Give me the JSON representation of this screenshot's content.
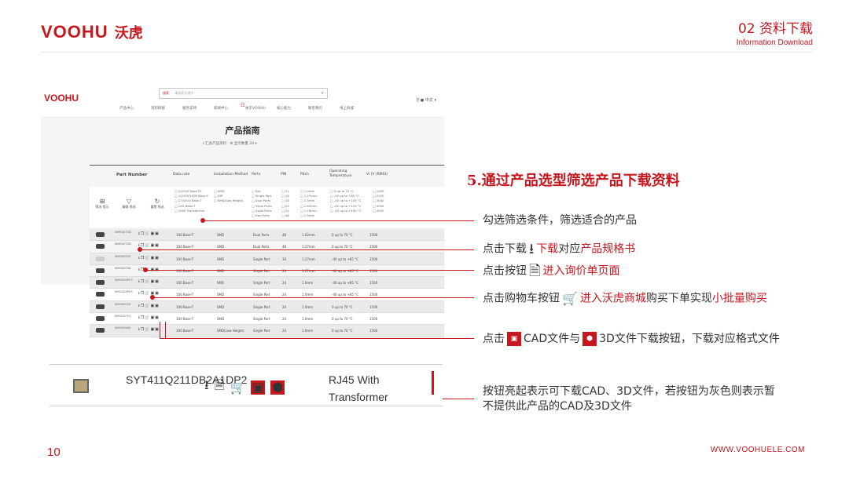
{
  "header": {
    "logo_en": "VOOHU",
    "logo_cn": "沃虎",
    "section_title": "02 资料下载",
    "section_sub": "Information Download"
  },
  "site": {
    "logo": "VOOHU",
    "search_tag": "搜索",
    "search_placeholder": "请搜索关键字",
    "search_icon": "search-icon",
    "nav": [
      "产品中心",
      "资料链接",
      "服务支持",
      "新闻中心",
      "关于VOOHU",
      "核心能力",
      "联系我们",
      "线上商城"
    ],
    "lang": "中文",
    "page_heading": "产品指南",
    "download_label": "汇总产品资料",
    "display_count": "显示数量 20",
    "columns": [
      "Part Number",
      "Data rate",
      "Installation Method",
      "Ports",
      "PIN",
      "Pitch",
      "Operating Temperature",
      "Vi (V (RMS))"
    ],
    "filters": {
      "data_rate": [
        "10/100 Base-TX",
        "10/100/1000 Base-T",
        "2.5/5/10 Base-T",
        "10G Base-T",
        "1000 Transformer"
      ],
      "install": [
        "SMD",
        "DIP",
        "SMD(Low Height)"
      ],
      "ports": [
        "N/A",
        "Single Port",
        "Dual Ports",
        "Triple Ports",
        "Quad Ports",
        "Hex Ports"
      ],
      "pin": [
        "12",
        "16",
        "18",
        "20",
        "24",
        "48"
      ],
      "pitch": [
        "1.0mm",
        "1.27mm",
        "1.5mm",
        "1.65mm",
        "1.78mm",
        "1.9mm"
      ],
      "temp": [
        "0 up to 70 °C",
        "-40 up to +85 °C",
        "-40 up to +105 °C",
        "-40 up to +125 °C",
        "-40 up to +150 °C"
      ],
      "vi": [
        "1500",
        "2250",
        "3000",
        "4000",
        "4500"
      ]
    },
    "side_buttons": [
      "筛选\n提示",
      "精确\n筛选",
      "重置\n筛选"
    ],
    "rows": [
      {
        "pn": "WHB4070D",
        "rate": "100 Base-T",
        "install": "SMD",
        "ports": "Dual Ports",
        "pin": "48",
        "pitch": "1.02mm",
        "temp": "0 up to 70 °C",
        "vi": "1500"
      },
      {
        "pn": "WHB4070D",
        "rate": "100 Base-T",
        "install": "SMD",
        "ports": "Dual Ports",
        "pin": "48",
        "pitch": "1.27mm",
        "temp": "0 up to 70 °C",
        "vi": "1500"
      },
      {
        "pn": "WHS6D100",
        "rate": "100 Base-T",
        "install": "SMD",
        "ports": "Single Port",
        "pin": "30",
        "pitch": "1.27mm",
        "temp": "-40 up to +85 °C",
        "vi": "1500"
      },
      {
        "pn": "WHS4D708",
        "rate": "100 Base-T",
        "install": "SMD",
        "ports": "Single Port",
        "pin": "24",
        "pitch": "1.27mm",
        "temp": "-40 up to +85 °C",
        "vi": "1500"
      },
      {
        "pn": "WHS4D4P03",
        "rate": "100 Base-T",
        "install": "SMD",
        "ports": "Single Port",
        "pin": "24",
        "pitch": "1.0mm",
        "temp": "-40 up to +85 °C",
        "vi": "1500"
      },
      {
        "pn": "WHS4D4P03",
        "rate": "100 Base-T",
        "install": "SMD",
        "ports": "Single Port",
        "pin": "24",
        "pitch": "1.0mm",
        "temp": "-40 up to +85 °C",
        "vi": "1500"
      },
      {
        "pn": "WHS4D703",
        "rate": "100 Base-T",
        "install": "SMD",
        "ports": "Single Port",
        "pin": "24",
        "pitch": "1.0mm",
        "temp": "0 up to 70 °C",
        "vi": "1500"
      },
      {
        "pn": "WHS4D701",
        "rate": "100 Base-T",
        "install": "SMD",
        "ports": "Single Port",
        "pin": "24",
        "pitch": "1.0mm",
        "temp": "0 up to 70 °C",
        "vi": "1500"
      },
      {
        "pn": "WHS4D400",
        "rate": "100 Base-T",
        "install": "SMD(Low Height)",
        "ports": "Single Port",
        "pin": "24",
        "pitch": "1.0mm",
        "temp": "0 up to 70 °C",
        "vi": "1500"
      }
    ]
  },
  "step_title": "5.通过产品选型筛选产品下载资料",
  "notes": {
    "n1": "勾选筛选条件，筛选适合的产品",
    "n2_a": "点击下载",
    "n2_b": "下载",
    "n2_c": "对应",
    "n2_d": "产品规格书",
    "n3_a": "点击按钮",
    "n3_b": "进入询价单页面",
    "n4_a": "点击购物车按钮",
    "n4_b": "进入沃虎商城",
    "n4_c": "购买下单实现",
    "n4_d": "小批量购买",
    "n5_a": "点击",
    "n5_b": "CAD文件与",
    "n5_c": "3D文件下载按钮，下载对应格式文件",
    "n6": "按钮亮起表示可下载CAD、3D文件，若按钮为灰色则表示暂不提供此产品的CAD及3D文件"
  },
  "zoom_row": {
    "pn": "SYT411Q211DB2A1DP2",
    "desc": "RJ45 With Transformer"
  },
  "footer": {
    "page_number": "10",
    "url": "WWW.VOOHUELE.COM"
  },
  "colors": {
    "accent": "#c8161d"
  }
}
